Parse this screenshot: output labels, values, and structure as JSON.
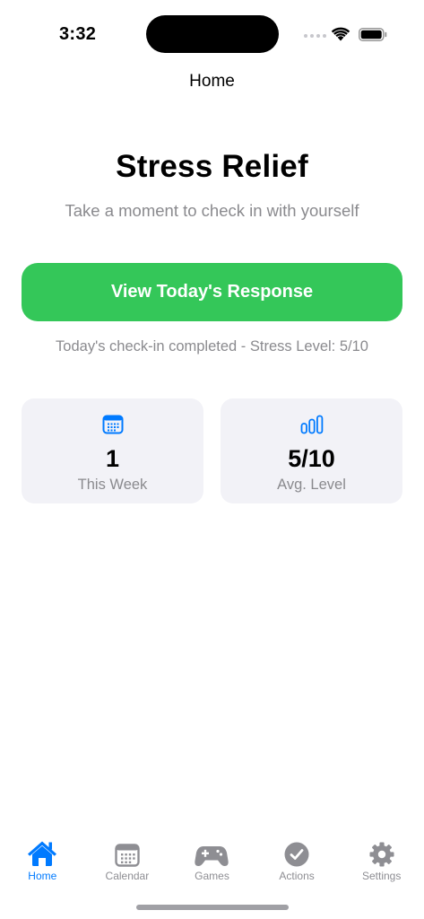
{
  "status_bar": {
    "time": "3:32"
  },
  "nav": {
    "title": "Home"
  },
  "hero": {
    "title": "Stress Relief",
    "subtitle": "Take a moment to check in with yourself"
  },
  "primary_action": {
    "label": "View Today's Response",
    "color": "#34c759"
  },
  "checkin_status": "Today's check-in completed - Stress Level: 5/10",
  "stats": [
    {
      "icon": "calendar-icon",
      "value": "1",
      "label": "This Week"
    },
    {
      "icon": "bar-chart-icon",
      "value": "5/10",
      "label": "Avg. Level"
    }
  ],
  "tab_bar": {
    "active_color": "#007aff",
    "inactive_color": "#8e8e93",
    "tabs": [
      {
        "label": "Home",
        "icon": "house-icon",
        "active": true
      },
      {
        "label": "Calendar",
        "icon": "calendar-icon",
        "active": false
      },
      {
        "label": "Games",
        "icon": "gamecontroller-icon",
        "active": false
      },
      {
        "label": "Actions",
        "icon": "checkmark-circle-icon",
        "active": false
      },
      {
        "label": "Settings",
        "icon": "gear-icon",
        "active": false
      }
    ]
  }
}
